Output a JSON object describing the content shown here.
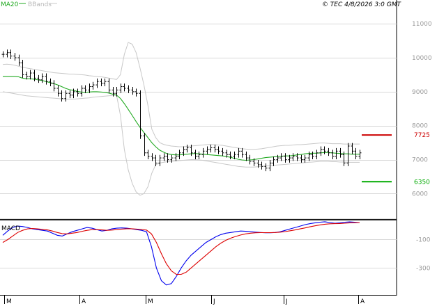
{
  "header": {
    "ma_label": "MA20",
    "bb_label": "BBands",
    "copyright": "© TEC 4/8/2026 3:0 GMT"
  },
  "colors": {
    "ma": "#22aa22",
    "bbands": "#c8c8c8",
    "price_bars": "#000000",
    "macd": "#0000ee",
    "signal": "#dd0000",
    "resistance": "#cc0000",
    "support": "#00aa00",
    "grid": "#d8d8d8"
  },
  "chart_data": [
    {
      "type": "ohlc",
      "title": "",
      "y_ticks": [
        6000,
        7000,
        8000,
        9000,
        10000,
        11000
      ],
      "y_tick_labels": [
        "6000",
        "7000",
        "8000",
        "9000",
        "10000",
        "11000"
      ],
      "ylim": [
        5250,
        11700
      ],
      "x_labels": [
        "M",
        "A",
        "M",
        "J",
        "J",
        "A"
      ],
      "levels": [
        {
          "name": "resistance",
          "value": 7725,
          "label": "7725"
        },
        {
          "name": "support",
          "value": 6350,
          "label": "6350"
        }
      ],
      "series": [
        {
          "name": "price",
          "kind": "bars",
          "values": [
            10100,
            10150,
            10050,
            10000,
            9850,
            9500,
            9450,
            9550,
            9400,
            9350,
            9450,
            9300,
            9250,
            9100,
            8950,
            8800,
            8950,
            8900,
            9000,
            8950,
            9100,
            9050,
            9150,
            9200,
            9300,
            9250,
            9300,
            9050,
            8950,
            9050,
            9150,
            9100,
            9050,
            9000,
            8950,
            7700,
            7200,
            7100,
            7050,
            6900,
            7050,
            7100,
            7000,
            7050,
            7100,
            7200,
            7300,
            7350,
            7200,
            7100,
            7150,
            7250,
            7300,
            7350,
            7300,
            7250,
            7200,
            7150,
            7100,
            7150,
            7250,
            7150,
            7050,
            6950,
            6900,
            6850,
            6800,
            6750,
            6900,
            7000,
            7050,
            7100,
            7000,
            7050,
            7100,
            7050,
            7000,
            7050,
            7150,
            7100,
            7200,
            7300,
            7250,
            7200,
            7100,
            7250,
            7150,
            6900,
            7400,
            7250,
            7100,
            7200
          ]
        },
        {
          "name": "MA20",
          "kind": "line",
          "values": [
            9450,
            9450,
            9450,
            9450,
            9440,
            9400,
            9380,
            9380,
            9370,
            9350,
            9330,
            9300,
            9270,
            9240,
            9200,
            9150,
            9100,
            9060,
            9040,
            9010,
            8990,
            8980,
            8990,
            9000,
            9000,
            8990,
            8980,
            8960,
            8930,
            8900,
            8800,
            8650,
            8480,
            8300,
            8120,
            7950,
            7800,
            7650,
            7500,
            7380,
            7280,
            7220,
            7170,
            7150,
            7140,
            7140,
            7150,
            7160,
            7170,
            7180,
            7170,
            7160,
            7150,
            7140,
            7130,
            7120,
            7110,
            7090,
            7070,
            7040,
            7010,
            6990,
            6980,
            6990,
            7000,
            7020,
            7040,
            7060,
            7070,
            7080,
            7090,
            7100,
            7110,
            7110,
            7120,
            7140,
            7150,
            7170,
            7180,
            7190,
            7190,
            7200,
            7210,
            7210,
            7200,
            7190,
            7180,
            7170,
            7170,
            7160,
            7160,
            7160
          ]
        },
        {
          "name": "upper_band",
          "kind": "line",
          "values": [
            9800,
            9810,
            9800,
            9780,
            9750,
            9720,
            9700,
            9680,
            9660,
            9640,
            9620,
            9600,
            9580,
            9560,
            9550,
            9540,
            9530,
            9520,
            9520,
            9510,
            9500,
            9490,
            9470,
            9460,
            9450,
            9440,
            9420,
            9400,
            9380,
            9360,
            9500,
            10100,
            10450,
            10400,
            10150,
            9700,
            9200,
            8600,
            7900,
            7650,
            7500,
            7450,
            7420,
            7400,
            7390,
            7380,
            7380,
            7390,
            7400,
            7410,
            7420,
            7430,
            7440,
            7450,
            7440,
            7430,
            7420,
            7400,
            7380,
            7360,
            7340,
            7320,
            7310,
            7300,
            7300,
            7310,
            7320,
            7340,
            7360,
            7380,
            7400,
            7410,
            7420,
            7420,
            7430,
            7440,
            7440,
            7450,
            7460,
            7470,
            7480,
            7490,
            7490,
            7480,
            7470,
            7470,
            7470,
            7460,
            7460,
            7460,
            7460,
            7460
          ]
        },
        {
          "name": "lower_band",
          "kind": "line",
          "values": [
            9000,
            8980,
            8960,
            8940,
            8920,
            8900,
            8880,
            8870,
            8860,
            8850,
            8840,
            8830,
            8820,
            8810,
            8800,
            8790,
            8780,
            8780,
            8780,
            8790,
            8800,
            8810,
            8820,
            8840,
            8850,
            8860,
            8870,
            8880,
            8890,
            8900,
            8300,
            7300,
            6700,
            6300,
            6050,
            5950,
            6000,
            6200,
            6600,
            6850,
            6900,
            6920,
            6940,
            6950,
            6960,
            6970,
            6980,
            6990,
            7000,
            7000,
            6990,
            6980,
            6960,
            6940,
            6920,
            6900,
            6880,
            6860,
            6840,
            6820,
            6800,
            6790,
            6780,
            6780,
            6780,
            6790,
            6800,
            6810,
            6820,
            6830,
            6840,
            6850,
            6860,
            6870,
            6880,
            6890,
            6900,
            6910,
            6920,
            6930,
            6940,
            6950,
            6950,
            6950,
            6940,
            6940,
            6930,
            6930,
            6920,
            6920,
            6920,
            6920
          ]
        }
      ]
    },
    {
      "type": "line",
      "title": "MACD",
      "y_ticks": [
        -100,
        -300
      ],
      "y_tick_labels": [
        "-100",
        "-300"
      ],
      "ylim": [
        -460,
        10
      ],
      "series": [
        {
          "name": "MACD",
          "values": [
            -70,
            -40,
            -15,
            -5,
            -8,
            -15,
            -25,
            -30,
            -35,
            -40,
            -55,
            -70,
            -75,
            -60,
            -45,
            -35,
            -25,
            -15,
            -20,
            -30,
            -40,
            -35,
            -25,
            -20,
            -18,
            -20,
            -25,
            -30,
            -35,
            -45,
            -150,
            -300,
            -390,
            -420,
            -410,
            -360,
            -300,
            -250,
            -210,
            -180,
            -150,
            -120,
            -100,
            -80,
            -65,
            -55,
            -50,
            -45,
            -40,
            -42,
            -45,
            -48,
            -50,
            -52,
            -52,
            -50,
            -45,
            -35,
            -25,
            -15,
            -5,
            5,
            12,
            18,
            22,
            25,
            20,
            15,
            18,
            22,
            24,
            22,
            20
          ]
        },
        {
          "name": "signal",
          "values": [
            -120,
            -100,
            -75,
            -50,
            -35,
            -25,
            -22,
            -25,
            -28,
            -32,
            -40,
            -50,
            -58,
            -60,
            -55,
            -50,
            -42,
            -35,
            -30,
            -30,
            -32,
            -35,
            -33,
            -30,
            -26,
            -24,
            -24,
            -26,
            -29,
            -33,
            -60,
            -120,
            -200,
            -270,
            -320,
            -345,
            -345,
            -330,
            -300,
            -270,
            -240,
            -210,
            -180,
            -150,
            -125,
            -105,
            -90,
            -78,
            -68,
            -60,
            -55,
            -52,
            -51,
            -51,
            -51,
            -50,
            -48,
            -44,
            -38,
            -32,
            -25,
            -18,
            -10,
            -3,
            3,
            8,
            11,
            12,
            13,
            15,
            18,
            19,
            20
          ]
        }
      ]
    }
  ]
}
